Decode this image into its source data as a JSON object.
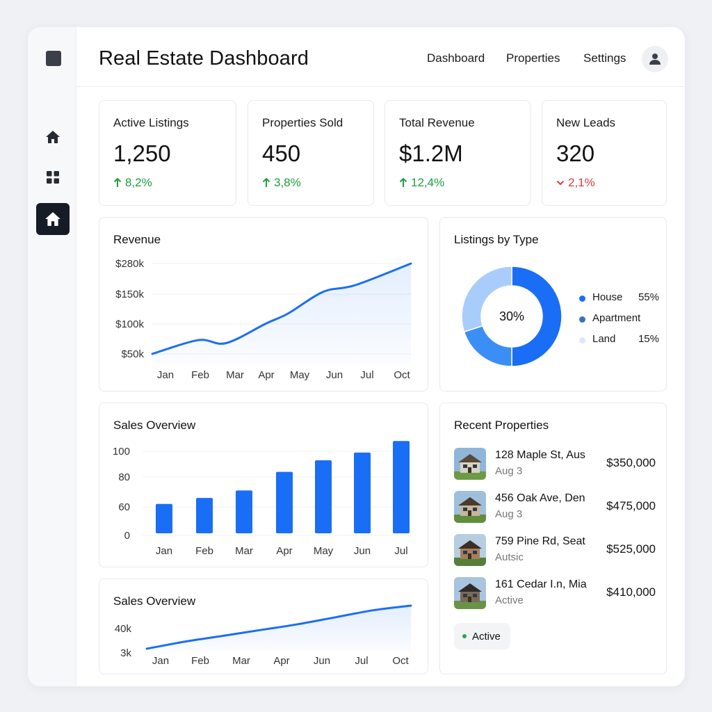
{
  "app": {
    "title": "Real Estate Dashboard"
  },
  "topnav": [
    "Dashboard",
    "Properties",
    "Settings"
  ],
  "sidebar": {
    "icons": [
      "square-logo-icon",
      "home-icon",
      "grid-icon",
      "home-icon"
    ],
    "active_index": 2
  },
  "stats": [
    {
      "label": "Active Listings",
      "value": "1,250",
      "change": "8,2%",
      "direction": "up"
    },
    {
      "label": "Properties Sold",
      "value": "450",
      "change": "3,8%",
      "direction": "up"
    },
    {
      "label": "Total Revenue",
      "value": "$1.2M",
      "change": "12,4%",
      "direction": "up"
    },
    {
      "label": "New Leads",
      "value": "320",
      "change": "2,1%",
      "direction": "down"
    }
  ],
  "colors": {
    "accent": "#1a6ef5",
    "up": "#1e9e3e",
    "down": "#e03a3a",
    "donut_mid": "#3b8ef5",
    "donut_light": "#a9cdfb",
    "legend_apartment": "#3b6fc4",
    "legend_land": "#dbe7fb"
  },
  "revenue_chart": {
    "title": "Revenue",
    "chart_data": {
      "type": "area",
      "categories": [
        "Jan",
        "Feb",
        "Mar",
        "Apr",
        "May",
        "Jun",
        "Jul",
        "Oct"
      ],
      "y_tick_labels": [
        "$280k",
        "$150k",
        "$100k",
        "$50k"
      ],
      "values": [
        50,
        73,
        68,
        101,
        118,
        160,
        188,
        280
      ],
      "grid": true
    }
  },
  "listings_chart": {
    "title": "Listings by Type",
    "center_label": "30%",
    "chart_data": {
      "type": "pie",
      "slices": [
        {
          "name": "House",
          "value": 50,
          "label": "55%"
        },
        {
          "name": "Apartment",
          "value": 20
        },
        {
          "name": "Land",
          "value": 30,
          "label": "15%"
        }
      ],
      "legend_position": "right"
    }
  },
  "sales_chart": {
    "title": "Sales Overview",
    "chart_data": {
      "type": "bar",
      "categories": [
        "Jan",
        "Feb",
        "Mar",
        "Apr",
        "May",
        "Jun",
        "Jul"
      ],
      "y_tick_labels": [
        "100",
        "80",
        "60",
        "0"
      ],
      "values": [
        62,
        66,
        71,
        84,
        93,
        99,
        108
      ],
      "grid": true
    }
  },
  "sales_chart_2": {
    "title": "Sales Overview",
    "chart_data": {
      "type": "area",
      "categories": [
        "Jan",
        "Feb",
        "Mar",
        "Apr",
        "Jun",
        "Jul",
        "Oct"
      ],
      "y_tick_labels": [
        "40k",
        "3k"
      ],
      "values": [
        3,
        9,
        14,
        19,
        24,
        30,
        36,
        40
      ],
      "grid": false
    }
  },
  "recent": {
    "title": "Recent Properties",
    "items": [
      {
        "address": "128 Maple St, Aus",
        "sub": "Aug 3",
        "price": "$350,000"
      },
      {
        "address": "456 Oak Ave, Den",
        "sub": "Aug 3",
        "price": "$475,000"
      },
      {
        "address": "759 Pine Rd, Seat",
        "sub": "Autsic",
        "price": "$525,000"
      },
      {
        "address": "161 Cedar I.n, Mia",
        "sub": "Active",
        "price": "$410,000"
      }
    ],
    "status_pill": "Active"
  }
}
